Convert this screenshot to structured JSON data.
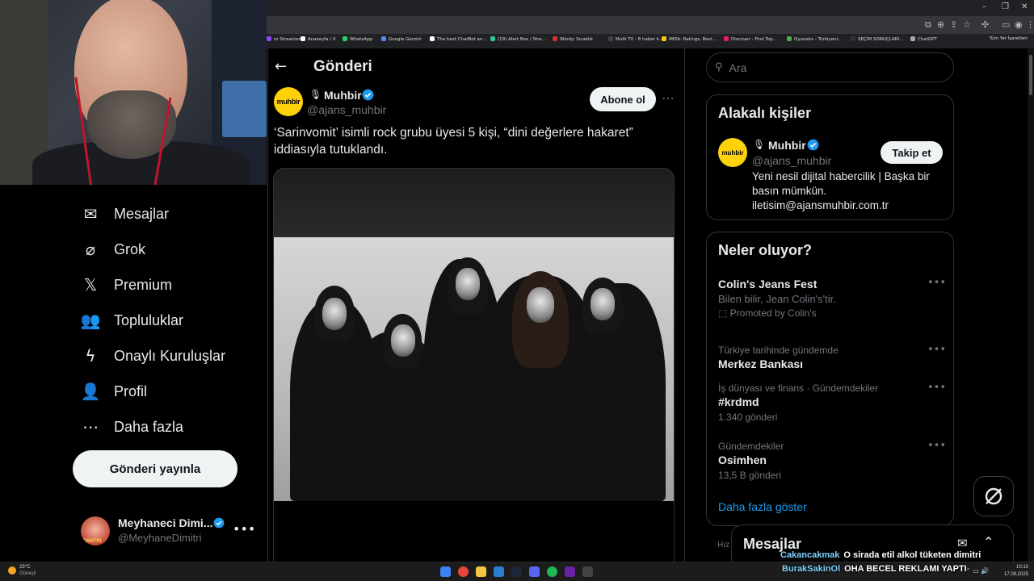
{
  "browser": {
    "window_controls": [
      "–",
      "❐",
      "✕"
    ],
    "bookmarks": [
      {
        "label": "or Streamers",
        "color": "#9146ff"
      },
      {
        "label": "Anasayfa / X",
        "color": "#ffffff"
      },
      {
        "label": "WhatsApp",
        "color": "#25d366"
      },
      {
        "label": "Google Gemini",
        "color": "#4e8cf7"
      },
      {
        "label": "The best ChatBot an...",
        "color": "#ffffff"
      },
      {
        "label": "(19) Alert Box / Stre...",
        "color": "#31c3a2"
      },
      {
        "label": "Windy: Sıcaklık",
        "color": "#d32f2f"
      },
      {
        "label": "Multi TV - 6 haber k...",
        "color": "#444444"
      },
      {
        "label": "IMDb: Ratings, Revi...",
        "color": "#f5c518"
      },
      {
        "label": "Discover - Find Top...",
        "color": "#e91e63"
      },
      {
        "label": "Oyuneks - Türkiyeni...",
        "color": "#4caf50"
      },
      {
        "label": "SEÇİM SONUÇLARI...",
        "color": "#333333"
      },
      {
        "label": "ChatGPT",
        "color": "#aaaaaa"
      }
    ],
    "all_bookmarks": "Tüm Yer İşaretleri"
  },
  "nav": {
    "items": [
      {
        "label": "Mesajlar",
        "icon": "mail-icon",
        "glyph": "✉"
      },
      {
        "label": "Grok",
        "icon": "grok-icon",
        "glyph": "⌀"
      },
      {
        "label": "Premium",
        "icon": "x-logo-icon",
        "glyph": "𝕏"
      },
      {
        "label": "Topluluklar",
        "icon": "communities-icon",
        "glyph": "👥"
      },
      {
        "label": "Onaylı Kuruluşlar",
        "icon": "lightning-icon",
        "glyph": "ϟ"
      },
      {
        "label": "Profil",
        "icon": "person-icon",
        "glyph": "👤"
      },
      {
        "label": "Daha fazla",
        "icon": "more-circle-icon",
        "glyph": "⋯"
      }
    ],
    "post_button": "Gönderi yayınla"
  },
  "account": {
    "name": "Meyhaneci Dimi...",
    "handle": "@MeyhaneDimitri",
    "avatar_text": "DIMITRI"
  },
  "main": {
    "title": "Gönderi",
    "post": {
      "author_avatar_text": "muhbir",
      "author_name": "Muhbir",
      "author_handle": "@ajans_muhbir",
      "subscribe_label": "Abone ol",
      "text": "‘Sarinvomit’ isimli rock grubu üyesi 5 kişi, “dini değerlere hakaret” iddiasıyla tutuklandı."
    }
  },
  "right": {
    "search_placeholder": "Ara",
    "related": {
      "title": "Alakalı kişiler",
      "avatar_text": "muhbir",
      "name": "Muhbir",
      "handle": "@ajans_muhbir",
      "follow_label": "Takip et",
      "bio": "Yeni nesil dijital habercilik | Başka bir basın mümkün. iletisim@ajansmuhbir.com.tr"
    },
    "trends": {
      "title": "Neler oluyor?",
      "items": [
        {
          "meta": "",
          "name": "Colin's Jeans Fest",
          "sub": "Bilen bilir, Jean Colin's'tir.",
          "promo": "Promoted by Colin's",
          "count": ""
        },
        {
          "meta": "Türkiye tarihinde gündemde",
          "name": "Merkez Bankası",
          "sub": "",
          "promo": "",
          "count": ""
        },
        {
          "meta": "İş dünyası ve finans · Gündemdekiler",
          "name": "#krdmd",
          "sub": "",
          "promo": "",
          "count": "1.340 gönderi"
        },
        {
          "meta": "Gündemdekiler",
          "name": "Osimhen",
          "sub": "",
          "promo": "",
          "count": "13,5 B gönderi"
        }
      ],
      "show_more": "Daha fazla göster"
    }
  },
  "messages_drawer": {
    "title": "Mesajlar",
    "fragment": "Hız"
  },
  "stream_chat": [
    {
      "user": "Cakancakmak",
      "message": "O sirada etil alkol tüketen dimitri"
    },
    {
      "user": "BurakSakinOl",
      "message": "OHA BECEL REKLAMI YAPTI"
    }
  ],
  "taskbar": {
    "temperature": "23°C",
    "weather": "Güneşli",
    "time": "10:10",
    "date": "17.09.2025"
  },
  "colors": {
    "accent": "#1d9bf0",
    "background": "#000000",
    "border": "#2f3336",
    "muted": "#71767b",
    "muhbir_yellow": "#ffd10a"
  }
}
